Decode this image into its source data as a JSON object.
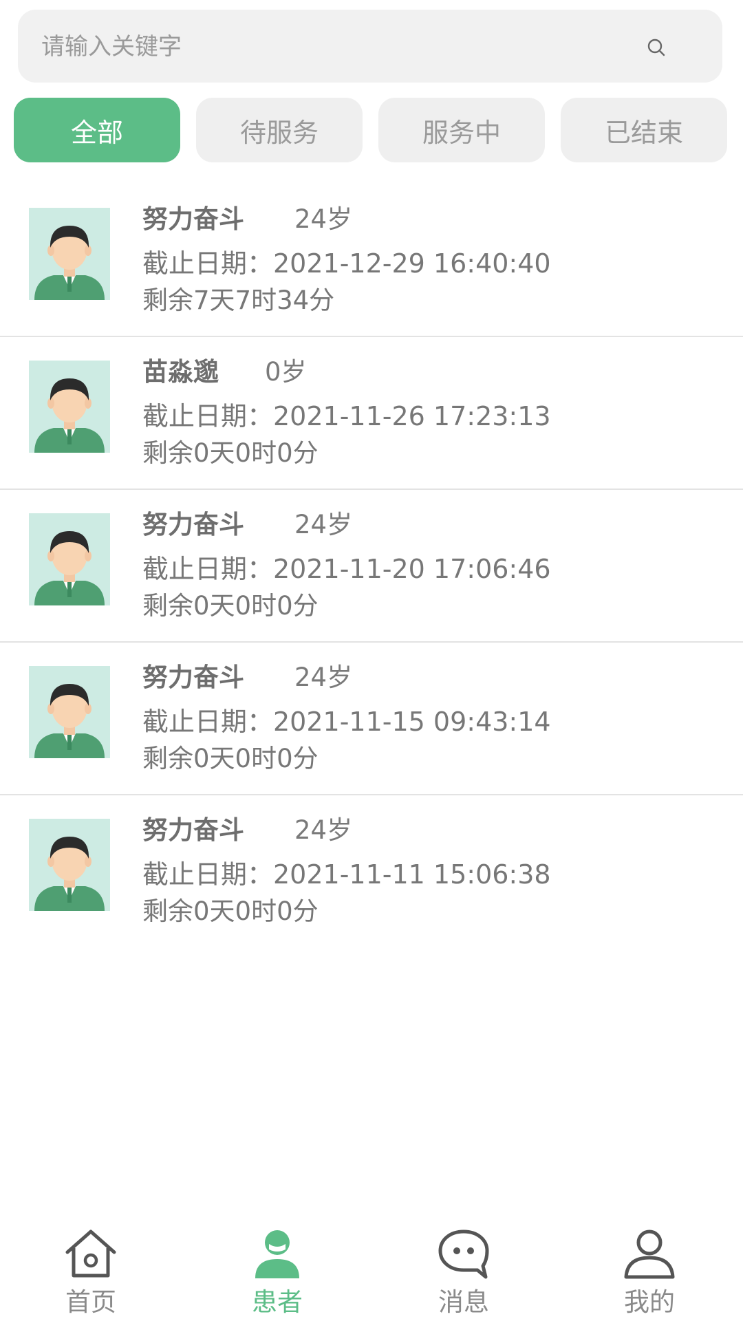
{
  "search": {
    "placeholder": "请输入关键字"
  },
  "tabs": [
    {
      "label": "全部",
      "active": true
    },
    {
      "label": "待服务",
      "active": false
    },
    {
      "label": "服务中",
      "active": false
    },
    {
      "label": "已结束",
      "active": false
    }
  ],
  "patients": [
    {
      "name": "努力奋斗",
      "age": "24岁",
      "deadline": "截止日期：2021-12-29 16:40:40",
      "remaining": "剩余7天7时34分"
    },
    {
      "name": "苗淼邈",
      "age": "0岁",
      "deadline": "截止日期：2021-11-26 17:23:13",
      "remaining": "剩余0天0时0分"
    },
    {
      "name": "努力奋斗",
      "age": "24岁",
      "deadline": "截止日期：2021-11-20 17:06:46",
      "remaining": "剩余0天0时0分"
    },
    {
      "name": "努力奋斗",
      "age": "24岁",
      "deadline": "截止日期：2021-11-15 09:43:14",
      "remaining": "剩余0天0时0分"
    },
    {
      "name": "努力奋斗",
      "age": "24岁",
      "deadline": "截止日期：2021-11-11 15:06:38",
      "remaining": "剩余0天0时0分"
    }
  ],
  "nav": [
    {
      "label": "首页",
      "icon": "home-icon"
    },
    {
      "label": "患者",
      "icon": "patient-icon",
      "active": true
    },
    {
      "label": "消息",
      "icon": "message-icon"
    },
    {
      "label": "我的",
      "icon": "profile-icon"
    }
  ],
  "colors": {
    "accent": "#5cbd87",
    "tab_inactive_bg": "#efefef",
    "avatar_bg": "#cdebe3"
  }
}
